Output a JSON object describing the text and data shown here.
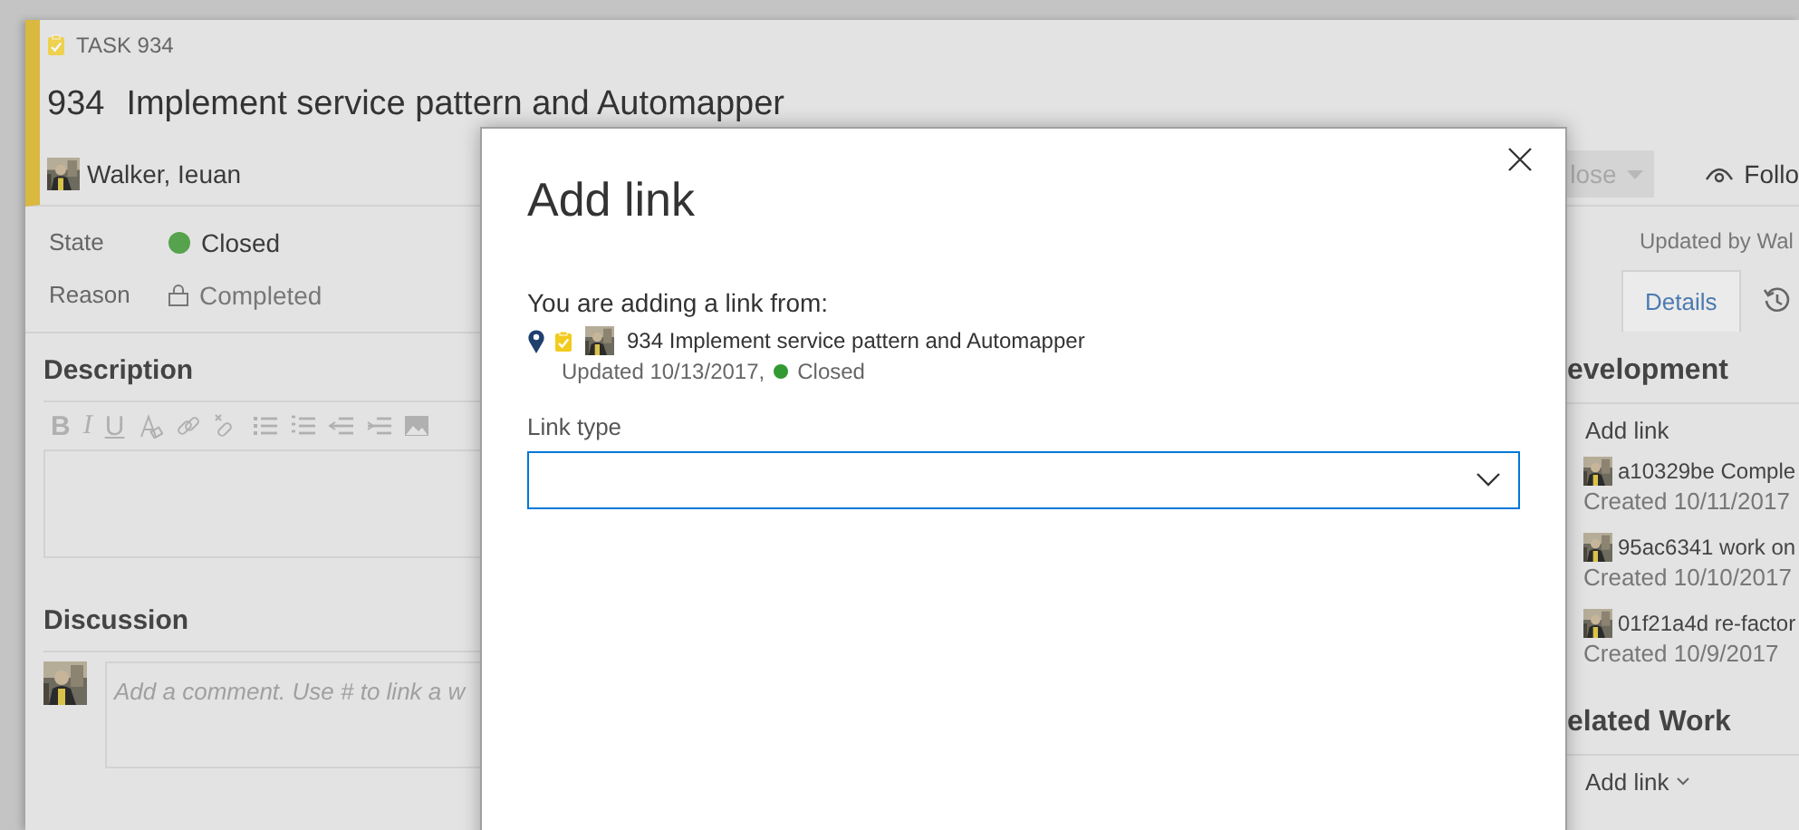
{
  "work_item": {
    "type_label": "TASK 934",
    "id": "934",
    "title": "Implement service pattern and Automapper",
    "assigned_to": "Walker, Ieuan"
  },
  "state_button": {
    "label": "lose"
  },
  "follow_button": {
    "label": "Follo"
  },
  "fields": [
    {
      "label": "State",
      "value": "Closed",
      "kind": "status"
    },
    {
      "label": "Reason",
      "value": "Completed",
      "kind": "locked"
    }
  ],
  "description": {
    "heading": "Description",
    "format_buttons": [
      "B",
      "I",
      "U"
    ]
  },
  "discussion": {
    "heading": "Discussion",
    "placeholder": "Add a comment. Use # to link a w"
  },
  "updated_by": "Updated by Wal",
  "tabs": [
    {
      "kind": "text",
      "label": "Details",
      "selected": true
    },
    {
      "kind": "history",
      "selected": false
    }
  ],
  "development": {
    "heading": "evelopment",
    "add_link": "Add link",
    "commits": [
      {
        "title": "a10329be Comple",
        "created": "Created 10/11/2017"
      },
      {
        "title": "95ac6341 work on",
        "created": "Created 10/10/2017"
      },
      {
        "title": "01f21a4d re-factor",
        "created": "Created 10/9/2017"
      }
    ]
  },
  "related_work": {
    "heading": "elated Work",
    "add_link": "Add link"
  },
  "dialog": {
    "title": "Add link",
    "intro": "You are adding a link from:",
    "source": {
      "title": "934 Implement service pattern and Automapper",
      "updated": "Updated 10/13/2017,",
      "state": "Closed"
    },
    "link_type": {
      "label": "Link type"
    }
  }
}
